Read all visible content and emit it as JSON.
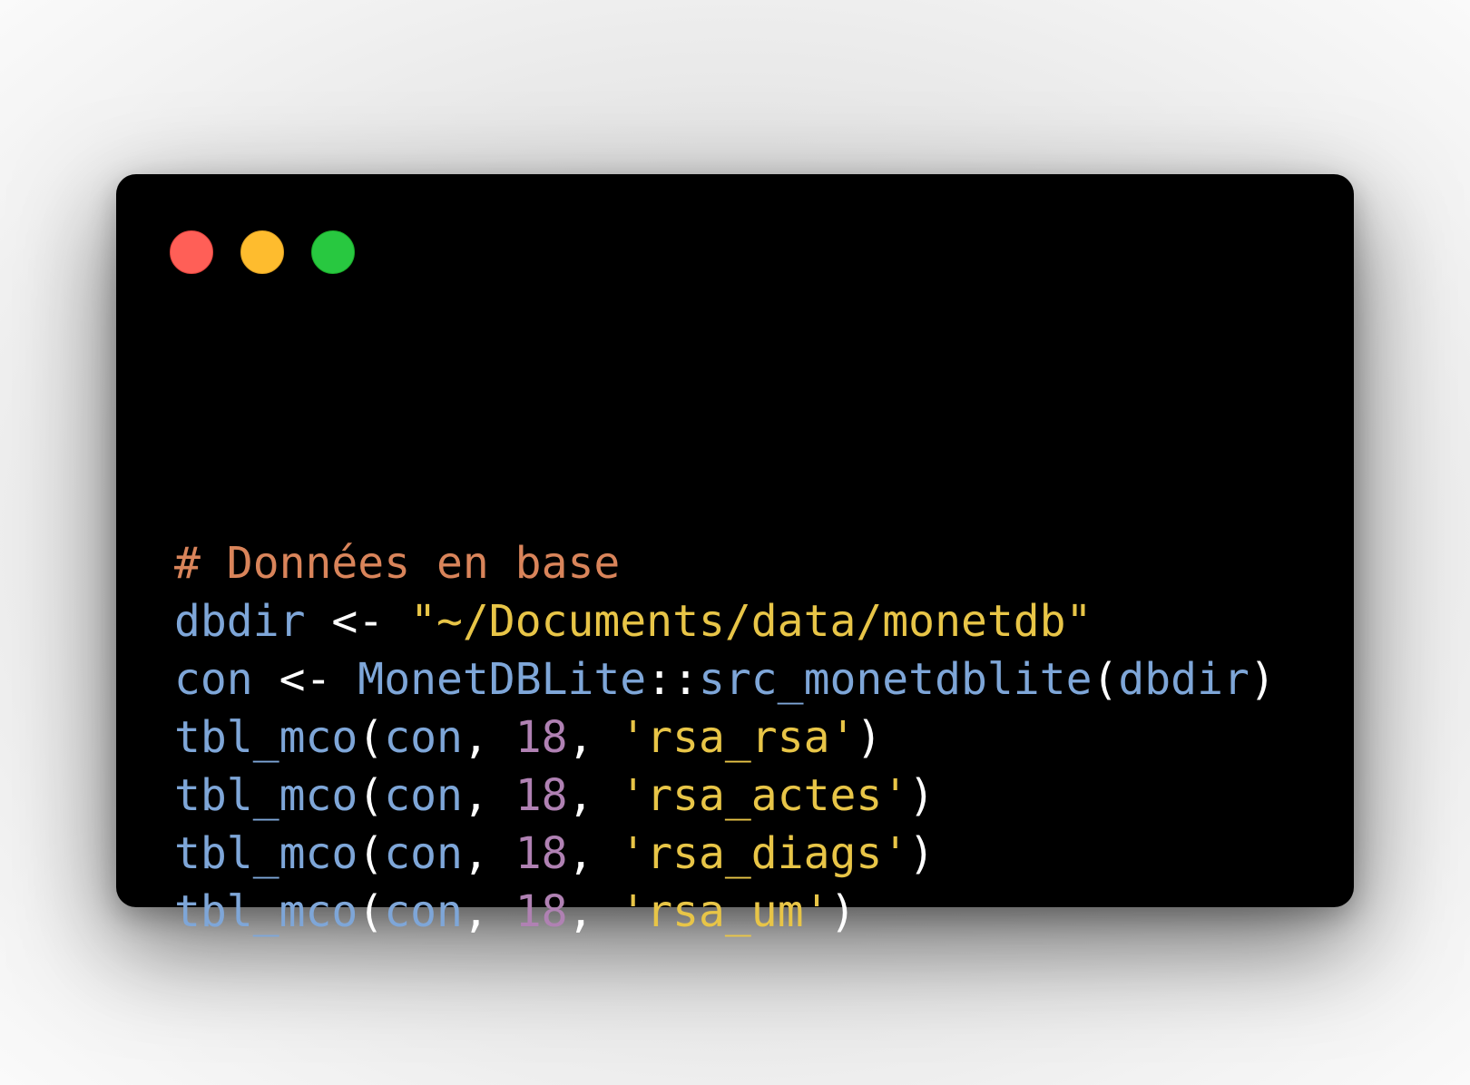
{
  "window": {
    "controls": {
      "close_color": "#ff5f57",
      "minimize_color": "#febc2e",
      "maximize_color": "#28c840"
    }
  },
  "colors": {
    "background": "#000000",
    "comment": "#d9845a",
    "identifier": "#7ea6d8",
    "operator": "#ffffff",
    "string": "#e8c547",
    "number": "#b081b3"
  },
  "code": {
    "language": "R",
    "lines": [
      [
        {
          "type": "comment",
          "text": "# Données en base"
        }
      ],
      [
        {
          "type": "ident",
          "text": "dbdir"
        },
        {
          "type": "op",
          "text": " <- "
        },
        {
          "type": "string",
          "text": "\"~/Documents/data/monetdb\""
        }
      ],
      [
        {
          "type": "ident",
          "text": "con"
        },
        {
          "type": "op",
          "text": " <- "
        },
        {
          "type": "ident",
          "text": "MonetDBLite"
        },
        {
          "type": "op",
          "text": "::"
        },
        {
          "type": "ident",
          "text": "src_monetdblite"
        },
        {
          "type": "punc",
          "text": "("
        },
        {
          "type": "ident",
          "text": "dbdir"
        },
        {
          "type": "punc",
          "text": ")"
        }
      ],
      [
        {
          "type": "ident",
          "text": "tbl_mco"
        },
        {
          "type": "punc",
          "text": "("
        },
        {
          "type": "ident",
          "text": "con"
        },
        {
          "type": "punc",
          "text": ", "
        },
        {
          "type": "number",
          "text": "18"
        },
        {
          "type": "punc",
          "text": ", "
        },
        {
          "type": "string",
          "text": "'rsa_rsa'"
        },
        {
          "type": "punc",
          "text": ")"
        }
      ],
      [
        {
          "type": "ident",
          "text": "tbl_mco"
        },
        {
          "type": "punc",
          "text": "("
        },
        {
          "type": "ident",
          "text": "con"
        },
        {
          "type": "punc",
          "text": ", "
        },
        {
          "type": "number",
          "text": "18"
        },
        {
          "type": "punc",
          "text": ", "
        },
        {
          "type": "string",
          "text": "'rsa_actes'"
        },
        {
          "type": "punc",
          "text": ")"
        }
      ],
      [
        {
          "type": "ident",
          "text": "tbl_mco"
        },
        {
          "type": "punc",
          "text": "("
        },
        {
          "type": "ident",
          "text": "con"
        },
        {
          "type": "punc",
          "text": ", "
        },
        {
          "type": "number",
          "text": "18"
        },
        {
          "type": "punc",
          "text": ", "
        },
        {
          "type": "string",
          "text": "'rsa_diags'"
        },
        {
          "type": "punc",
          "text": ")"
        }
      ],
      [
        {
          "type": "ident",
          "text": "tbl_mco"
        },
        {
          "type": "punc",
          "text": "("
        },
        {
          "type": "ident",
          "text": "con"
        },
        {
          "type": "punc",
          "text": ", "
        },
        {
          "type": "number",
          "text": "18"
        },
        {
          "type": "punc",
          "text": ", "
        },
        {
          "type": "string",
          "text": "'rsa_um'"
        },
        {
          "type": "punc",
          "text": ")"
        }
      ]
    ]
  }
}
